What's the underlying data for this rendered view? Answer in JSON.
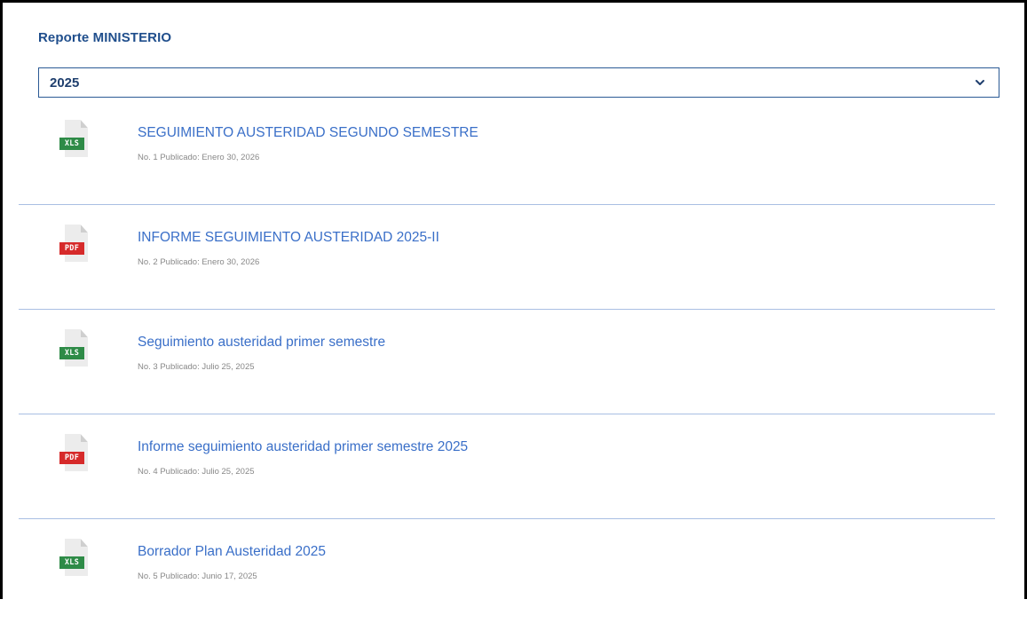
{
  "report": {
    "section_title": "Reporte MINISTERIO",
    "year_select": {
      "value": "2025",
      "icon": "chevron-down-icon"
    },
    "documents": [
      {
        "title": "SEGUIMIENTO AUSTERIDAD SEGUNDO SEMESTRE",
        "meta": "No. 1 Publicado: Enero 30, 2026",
        "file_type": "XLS",
        "icon": "xls-file-icon"
      },
      {
        "title": "INFORME SEGUIMIENTO AUSTERIDAD 2025-II",
        "meta": "No. 2 Publicado: Enero 30, 2026",
        "file_type": "PDF",
        "icon": "pdf-file-icon"
      },
      {
        "title": "Seguimiento austeridad primer semestre",
        "meta": "No. 3 Publicado: Julio 25, 2025",
        "file_type": "XLS",
        "icon": "xls-file-icon"
      },
      {
        "title": "Informe seguimiento austeridad primer semestre 2025",
        "meta": "No. 4 Publicado: Julio 25, 2025",
        "file_type": "PDF",
        "icon": "pdf-file-icon"
      },
      {
        "title": "Borrador Plan Austeridad 2025",
        "meta": "No. 5 Publicado: Junio 17, 2025",
        "file_type": "XLS",
        "icon": "xls-file-icon"
      }
    ]
  },
  "colors": {
    "title_blue": "#1f4e8c",
    "link_blue": "#3a6fc8",
    "divider": "#a9bfe3",
    "xls_green": "#2e8b47",
    "pdf_red": "#d62a2a"
  }
}
